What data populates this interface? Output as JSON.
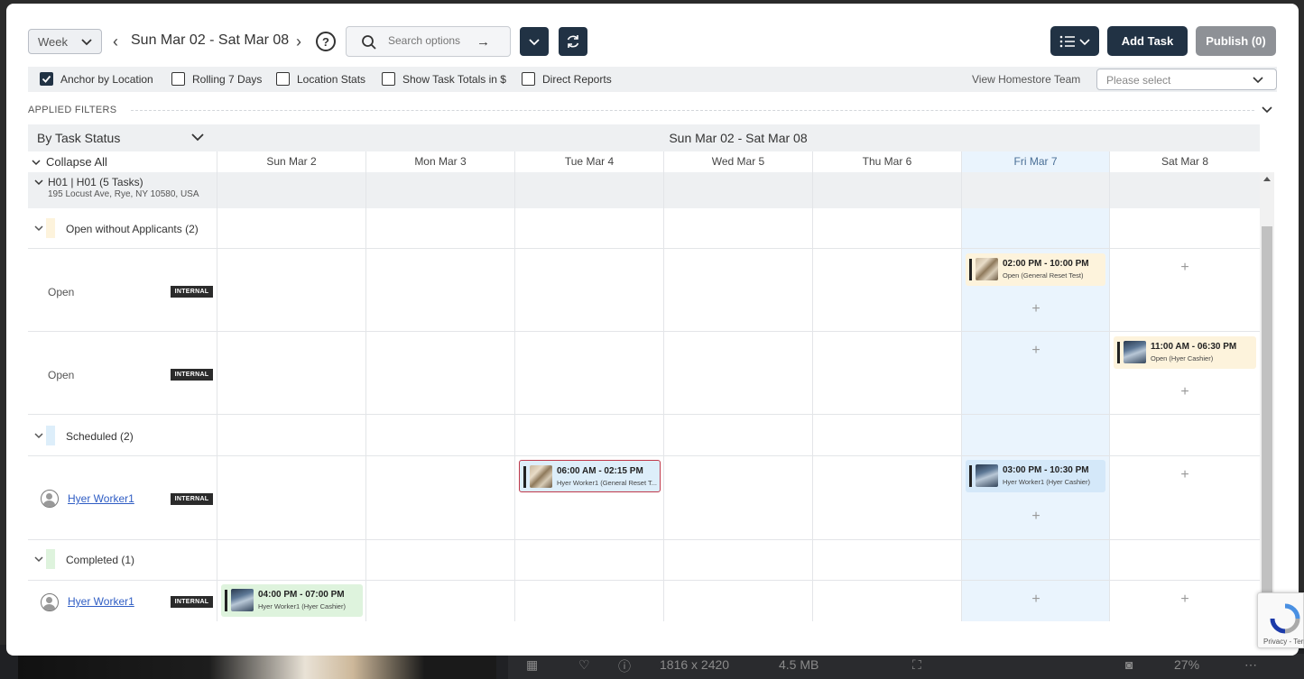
{
  "toolbar": {
    "view_mode": "Week",
    "date_range": "Sun Mar 02 - Sat Mar 08",
    "help_label": "?",
    "search_placeholder": "Search options",
    "add_task_label": "Add Task",
    "publish_label": "Publish (0)"
  },
  "options": {
    "anchor_by_location": {
      "label": "Anchor by Location",
      "checked": true
    },
    "rolling_7_days": {
      "label": "Rolling 7 Days",
      "checked": false
    },
    "location_stats": {
      "label": "Location Stats",
      "checked": false
    },
    "show_task_totals": {
      "label": "Show Task Totals in $",
      "checked": false
    },
    "direct_reports": {
      "label": "Direct Reports",
      "checked": false
    },
    "view_team_label": "View Homestore Team",
    "team_placeholder": "Please select"
  },
  "applied_filters_label": "APPLIED FILTERS",
  "grid": {
    "group_by": "By Task Status",
    "week_title": "Sun Mar 02 - Sat Mar 08",
    "collapse_all": "Collapse All",
    "days": [
      "Sun Mar 2",
      "Mon Mar 3",
      "Tue Mar 4",
      "Wed Mar 5",
      "Thu Mar 6",
      "Fri Mar 7",
      "Sat Mar 8"
    ],
    "highlighted_day": "Fri Mar 7",
    "location": {
      "title": "H01 | H01 (5 Tasks)",
      "address": "195 Locust Ave, Rye, NY 10580, USA"
    },
    "sections": {
      "open": {
        "label": "Open without Applicants (2)",
        "color": "#fdf3dc"
      },
      "scheduled": {
        "label": "Scheduled (2)",
        "color": "#ddeefa"
      },
      "completed": {
        "label": "Completed (1)",
        "color": "#def3dd"
      }
    },
    "rows": {
      "open1": {
        "label": "Open",
        "badge": "INTERNAL"
      },
      "open2": {
        "label": "Open",
        "badge": "INTERNAL"
      },
      "sched1": {
        "worker": "Hyer Worker1",
        "badge": "INTERNAL"
      },
      "comp1": {
        "worker": "Hyer Worker1",
        "badge": "INTERNAL"
      }
    },
    "tasks": {
      "t1": {
        "time": "02:00 PM - 10:00 PM",
        "desc": "Open (General Reset Test)"
      },
      "t2": {
        "time": "11:00 AM - 06:30 PM",
        "desc": "Open (Hyer Cashier)"
      },
      "t3": {
        "time": "06:00 AM - 02:15 PM",
        "desc": "Hyer Worker1 (General Reset T..."
      },
      "t4": {
        "time": "03:00 PM - 10:30 PM",
        "desc": "Hyer Worker1 (Hyer Cashier)"
      },
      "t5": {
        "time": "04:00 PM - 07:00 PM",
        "desc": "Hyer Worker1 (Hyer Cashier)"
      }
    },
    "add_symbol": "+"
  },
  "viewer": {
    "dimensions": "1816 x 2420",
    "size": "4.5 MB",
    "zoom": "27%"
  },
  "recaptcha_text": "Privacy - Terms"
}
